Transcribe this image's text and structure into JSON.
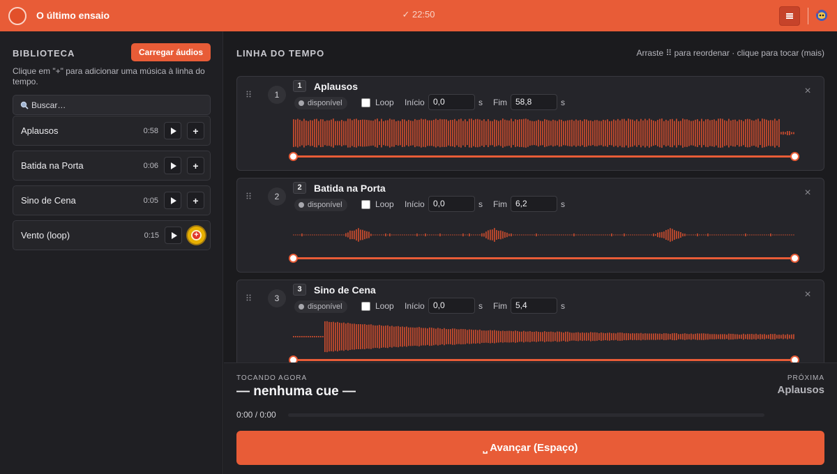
{
  "app": {
    "title": "O último ensaio",
    "clock": "✓ 22:50"
  },
  "colors": {
    "accent": "#e85c37",
    "background": "#1b1b1e",
    "panel": "#25252a",
    "highlight": "#e8b000"
  },
  "header": {
    "icons": [
      "record-circle-icon",
      "menu-icon",
      "theme-toggle-icon"
    ]
  },
  "library": {
    "title": "BIBLIOTECA",
    "load_button": "Carregar áudios",
    "help_text": "Clique em \"+\" para adicionar uma música à linha do tempo.",
    "search_placeholder": "Buscar…",
    "items": [
      {
        "name": "Aplausos",
        "duration": "0:58"
      },
      {
        "name": "Batida na Porta",
        "duration": "0:06"
      },
      {
        "name": "Sino de Cena",
        "duration": "0:05"
      },
      {
        "name": "Vento (loop)",
        "duration": "0:15"
      }
    ],
    "add_symbol": "+"
  },
  "timeline": {
    "title": "LINHA DO TEMPO",
    "hint": "Arraste ⠿ para reordenar · clique para tocar (mais)",
    "labels": {
      "loop": "Loop",
      "start": "Início",
      "end": "Fim",
      "unit": "s",
      "close": "×"
    },
    "cues": [
      {
        "index": "1",
        "number": "1",
        "name": "Aplausos",
        "status": "disponível",
        "loop": false,
        "start": "0,0",
        "end": "58,8",
        "waveform": "dense"
      },
      {
        "index": "2",
        "number": "2",
        "name": "Batida na Porta",
        "status": "disponível",
        "loop": false,
        "start": "0,0",
        "end": "6,2",
        "waveform": "sparse"
      },
      {
        "index": "3",
        "number": "3",
        "name": "Sino de Cena",
        "status": "disponível",
        "loop": false,
        "start": "0,0",
        "end": "5,4",
        "waveform": "decay"
      }
    ]
  },
  "transport": {
    "now_label": "TOCANDO AGORA",
    "now_value": "— nenhuma cue —",
    "next_label": "PRÓXIMA",
    "next_value": "Aplausos",
    "time": "0:00 / 0:00",
    "progress": 0,
    "advance_button": "⎵ Avançar (Espaço)"
  }
}
